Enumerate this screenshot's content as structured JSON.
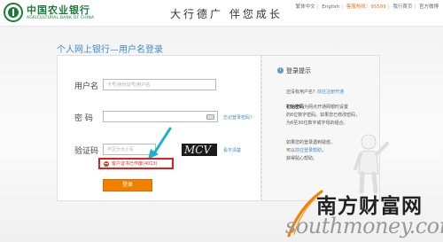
{
  "header": {
    "bank_name_cn": "中国农业银行",
    "bank_name_en": "AGRICULTURAL BANK OF CHINA",
    "slogan": "大行德广 伴您成长",
    "nav": {
      "traditional": "繁体中文",
      "english": "English",
      "hotline": "客服热线：95599",
      "site_home": "我行首页",
      "weibo": "官方微博"
    },
    "brand_color": "#1c7a3a"
  },
  "title": "个人网上银行—用户名登录",
  "form": {
    "username_label": "用户名",
    "username_placeholder": "卡号/身份证号/用户名",
    "password_label": "密  码",
    "forgot_password": "忘记登录密码？",
    "captcha_label": "验证码",
    "captcha_placeholder": "不区分大小写",
    "captcha_image_text": "MCV",
    "captcha_refresh": "看不清楚",
    "error_message": "客户证书已作废(4013)",
    "login_button": "登录"
  },
  "tips": {
    "heading": "登录提示",
    "line1_prefix": "还没有用户名？",
    "line1_link": "前往注册开通",
    "line2_bold": "初始密码",
    "line2_rest": "为网点开通网银时设置",
    "line3": "的6位数字密码。如果您已修改密码，",
    "line4": "为6至30位数字或字母的组合。",
    "line5": "如果您的登录遇到疑惑，",
    "line6_prefix": "可以",
    "line6_link": "前往登录帮助",
    "line6_suffix": "，",
    "line7": "获得贴心帮助。"
  },
  "watermark": {
    "cn": "南方财富网",
    "en": "southmoney.com"
  },
  "accent_color": "#f08000",
  "error_color": "#e02020"
}
